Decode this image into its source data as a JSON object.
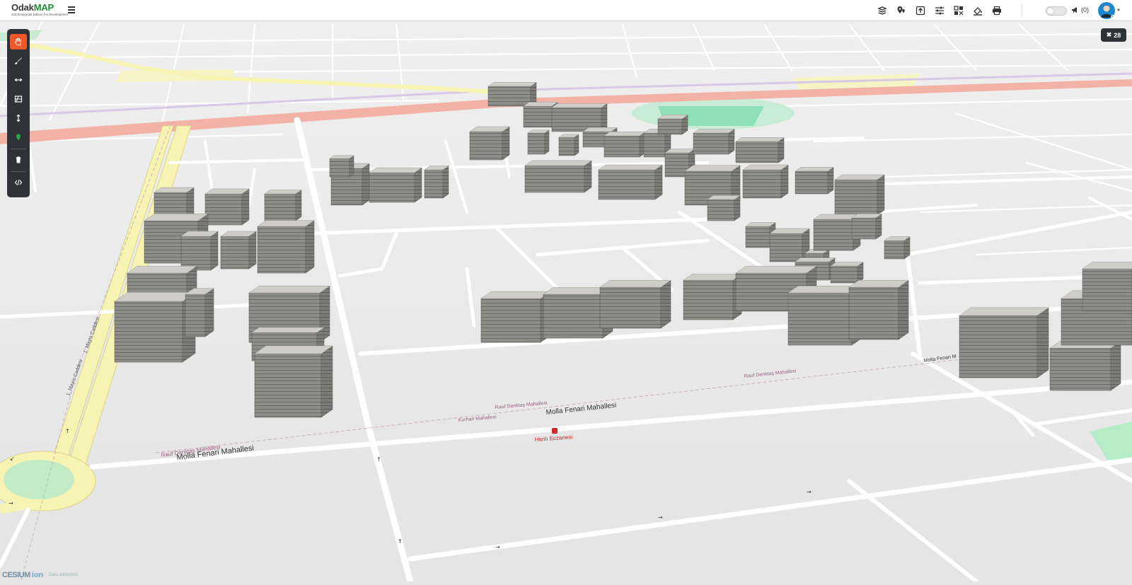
{
  "app": {
    "logo_text_part1": "Odak",
    "logo_text_part2": "MAP",
    "logo_subtitle": "GIS Enterprise Edition For Development"
  },
  "header": {
    "tools": [
      {
        "name": "layers-icon"
      },
      {
        "name": "location-pins-icon"
      },
      {
        "name": "upload-icon"
      },
      {
        "name": "sliders-icon"
      },
      {
        "name": "grid-tools-icon"
      },
      {
        "name": "paint-bucket-icon"
      },
      {
        "name": "print-icon"
      }
    ],
    "notification_count": "(0)"
  },
  "left_toolbar": {
    "items": [
      {
        "name": "pan-hand-icon",
        "active": true
      },
      {
        "name": "draw-brush-icon",
        "active": false
      },
      {
        "name": "measure-distance-icon",
        "active": false
      },
      {
        "name": "measure-area-icon",
        "active": false
      },
      {
        "name": "measure-height-icon",
        "active": false
      },
      {
        "name": "point-marker-icon",
        "active": false
      },
      {
        "name": "trash-icon",
        "active": false
      },
      {
        "name": "code-icon",
        "active": false
      }
    ]
  },
  "map_badge": {
    "count": "28"
  },
  "map_labels": {
    "street_1": "Molla Fenari Mahallesi",
    "street_2": "Molla Fenari Mahallesi",
    "street_3": "Rauf Denktaş Mahallesi",
    "street_4": "Rauf Denktaş Mahallesi",
    "street_5": "Kurhan Mahallesi",
    "street_6": "Rauf Denktaş Mahallesi",
    "street_7": "Molla Fenari M",
    "avenue_1": "1. Mayıs Caddesi",
    "avenue_2": "1. Mayıs Caddesi",
    "poi_1": "Hanlı Eczanesi"
  },
  "credit": {
    "logo": "CESIUM",
    "ion": "ion",
    "link": "Data attribution"
  },
  "colors": {
    "accent": "#f0572b",
    "toolbar_bg": "#2f3236",
    "map_bg": "#e4e4e4",
    "road": "#ffffff",
    "highway": "#f2b3a6",
    "avenue": "#f7f3b3",
    "park": "#8ee0b8",
    "building": "#8a8a87",
    "poi": "#d9272e"
  }
}
